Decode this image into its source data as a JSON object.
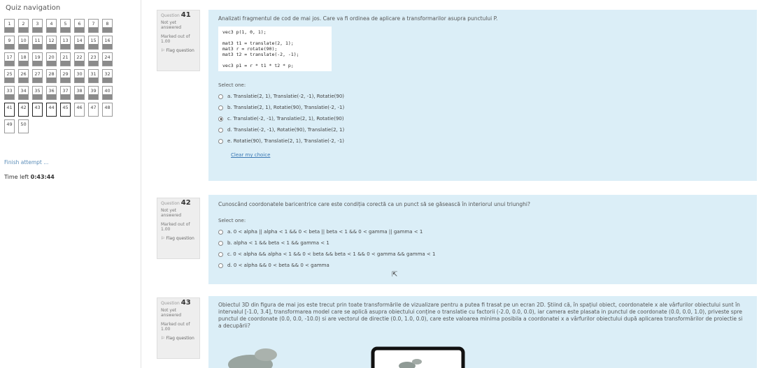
{
  "sidebar": {
    "title": "Quiz navigation",
    "buttons": [
      {
        "n": "1"
      },
      {
        "n": "2"
      },
      {
        "n": "3"
      },
      {
        "n": "4"
      },
      {
        "n": "5"
      },
      {
        "n": "6"
      },
      {
        "n": "7"
      },
      {
        "n": "8"
      },
      {
        "n": "9"
      },
      {
        "n": "10"
      },
      {
        "n": "11"
      },
      {
        "n": "12"
      },
      {
        "n": "13"
      },
      {
        "n": "14"
      },
      {
        "n": "15"
      },
      {
        "n": "16"
      },
      {
        "n": "17"
      },
      {
        "n": "18"
      },
      {
        "n": "19"
      },
      {
        "n": "20"
      },
      {
        "n": "21"
      },
      {
        "n": "22"
      },
      {
        "n": "23"
      },
      {
        "n": "24"
      },
      {
        "n": "25"
      },
      {
        "n": "26"
      },
      {
        "n": "27"
      },
      {
        "n": "28"
      },
      {
        "n": "29"
      },
      {
        "n": "30"
      },
      {
        "n": "31"
      },
      {
        "n": "32"
      },
      {
        "n": "33"
      },
      {
        "n": "34"
      },
      {
        "n": "35"
      },
      {
        "n": "36"
      },
      {
        "n": "37"
      },
      {
        "n": "38"
      },
      {
        "n": "39"
      },
      {
        "n": "40"
      },
      {
        "n": "41"
      },
      {
        "n": "42"
      },
      {
        "n": "43"
      },
      {
        "n": "44"
      },
      {
        "n": "45"
      },
      {
        "n": "46"
      },
      {
        "n": "47"
      },
      {
        "n": "48"
      },
      {
        "n": "49"
      },
      {
        "n": "50"
      }
    ],
    "finish_label": "Finish attempt ...",
    "time_left_label": "Time left",
    "time_left_value": "0:43:44"
  },
  "questions": [
    {
      "prefix": "Question",
      "number": "41",
      "state": "Not yet answered",
      "marked": "Marked out of 1.00",
      "flag": "Flag question",
      "text": "Analizati fragmentul de cod de mai jos. Care va fi ordinea de aplicare a transformarilor asupra punctului P.",
      "code": "vec3 p(1, 0, 1);\n\nmat3 t1 = translate(2, 1);\nmat3 r = rotate(90);\nmat3 t2 = translate(-2, -1);\n\nvec3 p1 = r * t1 * t2 * p;",
      "select_label": "Select one:",
      "options": [
        {
          "label": "a. Translatie(2, 1), Translatie(-2, -1), Rotatie(90)"
        },
        {
          "label": "b. Translatie(2, 1), Rotatie(90), Translatie(-2, -1)"
        },
        {
          "label": "c. Translatie(-2, -1), Translatie(2, 1), Rotatie(90)"
        },
        {
          "label": "d. Translatie(-2, -1), Rotatie(90), Translatie(2, 1)"
        },
        {
          "label": "e. Rotatie(90), Translatie(2, 1), Translatie(-2, -1)"
        }
      ],
      "clear_label": "Clear my choice"
    },
    {
      "prefix": "Question",
      "number": "42",
      "state": "Not yet answered",
      "marked": "Marked out of 1.00",
      "flag": "Flag question",
      "text": "Cunoscând coordonatele baricentrice care este condiția corectă ca un punct să se găsească în interiorul unui triunghi?",
      "select_label": "Select one:",
      "options": [
        {
          "label": "a. 0 < alpha || alpha < 1 && 0 < beta || beta < 1 && 0 < gamma || gamma < 1"
        },
        {
          "label": "b. alpha < 1 && beta < 1 && gamma < 1"
        },
        {
          "label": "c. 0 < alpha && alpha < 1 && 0 < beta && beta < 1 && 0 < gamma && gamma < 1"
        },
        {
          "label": "d. 0 < alpha && 0 < beta && 0 < gamma"
        }
      ]
    },
    {
      "prefix": "Question",
      "number": "43",
      "state": "Not yet answered",
      "marked": "Marked out of 1.00",
      "flag": "Flag question",
      "text": "Obiectul 3D din figura de mai jos este trecut prin toate transformările de vizualizare pentru a putea fi trasat pe un ecran 2D. Știind că, în spațiul obiect, coordonatele x ale vârfurilor obiectului sunt în intervalul [-1.0, 3.4], transformarea model care se aplică asupra obiectului conține o translatie cu factorii (-2.0, 0.0, 0.0), iar camera este plasata in punctul de coordonate (0.0, 0.0, 1.0), priveste spre punctul de coordonate (0.0, 0.0, -10.0) si are vectorul de directie (0.0, 1.0, 0.0), care este valoarea minima posibila a coordonatei x a vârfurilor obiectului după aplicarea transformărilor de proiectie si a decupării?"
    }
  ]
}
